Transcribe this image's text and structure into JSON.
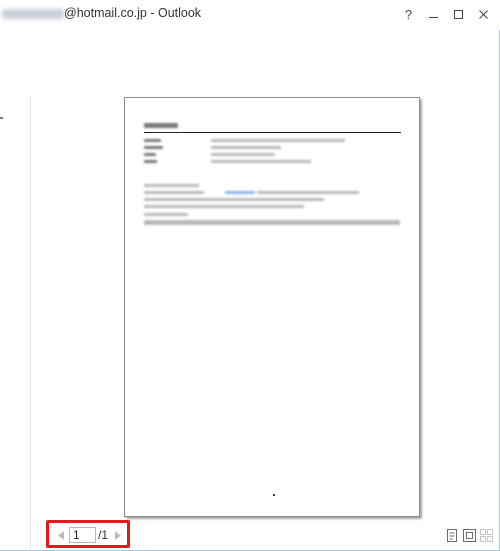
{
  "window": {
    "title_redacted": "",
    "title": "@hotmail.co.jp - Outlook",
    "controls": {
      "help": "?",
      "minimize": "–",
      "maximize": "□",
      "close": "✕"
    }
  },
  "page": {
    "content_is_blurred": true
  },
  "pager": {
    "current_page": "1",
    "total": "/1",
    "prev_icon": "triangle-left-icon",
    "next_icon": "triangle-right-icon"
  },
  "view_options": {
    "icons": [
      "actual-size-icon",
      "fit-page-icon",
      "multi-page-icon"
    ]
  },
  "colors": {
    "highlight_box": "#e8161d",
    "window_border": "#a8c4e0",
    "page_border": "#8a8a8a"
  }
}
